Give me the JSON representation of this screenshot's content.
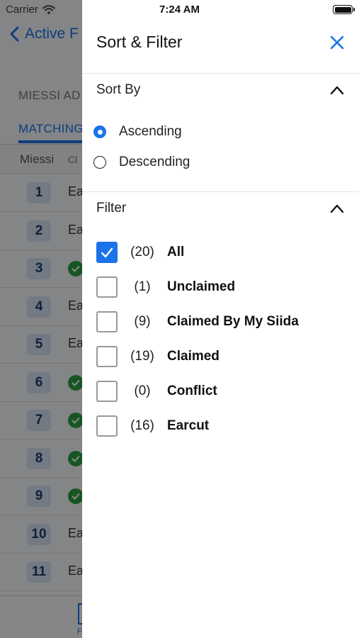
{
  "status_bar": {
    "carrier": "Carrier",
    "time": "7:24 AM"
  },
  "background": {
    "back_label": "Active F",
    "section_label": "MIESSI AD",
    "tab_label": "MATCHING",
    "col1": "Miessi",
    "col2": "Cl",
    "rows": [
      {
        "num": "1",
        "text": "Ea",
        "check": false
      },
      {
        "num": "2",
        "text": "Ea",
        "check": false
      },
      {
        "num": "3",
        "text": "",
        "check": true
      },
      {
        "num": "4",
        "text": "Ea",
        "check": false
      },
      {
        "num": "5",
        "text": "Ea",
        "check": false
      },
      {
        "num": "6",
        "text": "",
        "check": true
      },
      {
        "num": "7",
        "text": "",
        "check": true
      },
      {
        "num": "8",
        "text": "",
        "check": true
      },
      {
        "num": "9",
        "text": "",
        "check": true
      },
      {
        "num": "10",
        "text": "Ea",
        "check": false
      },
      {
        "num": "11",
        "text": "Ea",
        "check": false
      }
    ],
    "tabbar_label": "F"
  },
  "drawer": {
    "title": "Sort & Filter",
    "sort_section": "Sort By",
    "sort_options": [
      {
        "label": "Ascending",
        "selected": true
      },
      {
        "label": "Descending",
        "selected": false
      }
    ],
    "filter_section": "Filter",
    "filters": [
      {
        "count": "(20)",
        "label": "All",
        "checked": true
      },
      {
        "count": "(1)",
        "label": "Unclaimed",
        "checked": false
      },
      {
        "count": "(9)",
        "label": "Claimed By My Siida",
        "checked": false
      },
      {
        "count": "(19)",
        "label": "Claimed",
        "checked": false
      },
      {
        "count": "(0)",
        "label": "Conflict",
        "checked": false
      },
      {
        "count": "(16)",
        "label": "Earcut",
        "checked": false
      }
    ]
  },
  "colors": {
    "accent": "#1a73e8",
    "claimed_green": "#2e9e43"
  }
}
